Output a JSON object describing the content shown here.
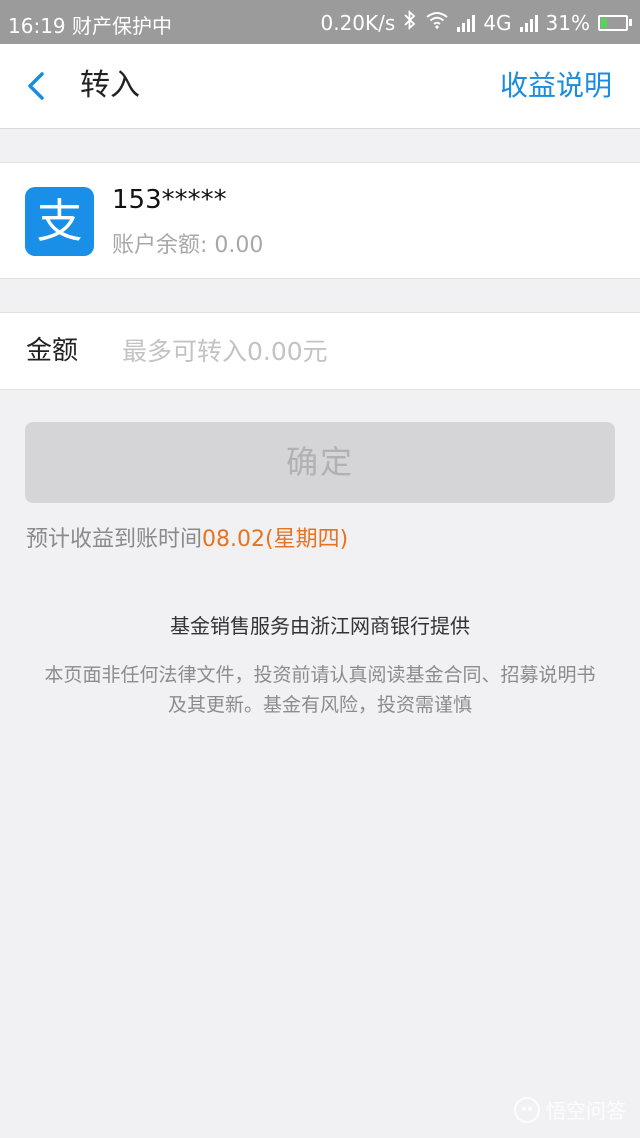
{
  "status_bar": {
    "time": "16:19",
    "notice": "财产保护中",
    "speed": "0.20K/s",
    "network": "4G",
    "battery": "31%",
    "battery_level": 0.31,
    "battery_color": "#58d35a"
  },
  "nav": {
    "title": "转入",
    "action": "收益说明",
    "back_icon": "chevron-left-icon"
  },
  "account": {
    "logo_glyph": "支",
    "logo_color": "#1a8fe8",
    "name": "153*****",
    "balance": "账户余额: 0.00"
  },
  "amount": {
    "label": "金额",
    "placeholder": "最多可转入0.00元",
    "value": ""
  },
  "confirm_button": {
    "label": "确定"
  },
  "estimate": {
    "prefix": "预计收益到账时间",
    "date": "08.02(星期四)",
    "date_color": "#e8731e"
  },
  "footer": {
    "provider": "基金销售服务由浙江网商银行提供",
    "disclaimer": "本页面非任何法律文件，投资前请认真阅读基金合同、招募说明书及其更新。基金有风险，投资需谨慎"
  },
  "watermark": {
    "text": "悟空问答"
  }
}
